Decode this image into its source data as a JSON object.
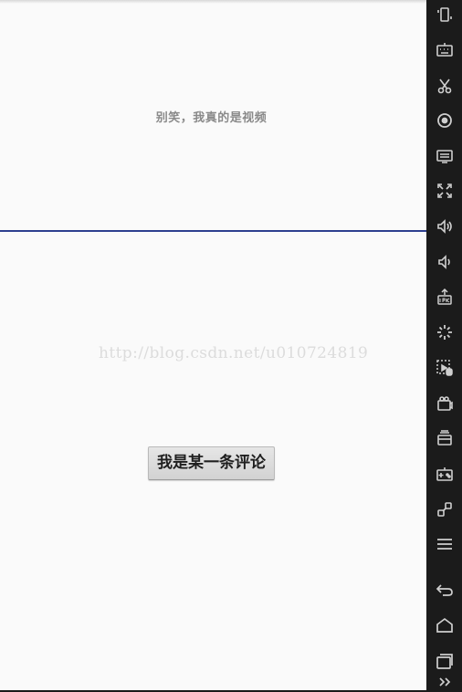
{
  "video": {
    "text": "别笑，我真的是视频"
  },
  "watermark": {
    "text": "http://blog.csdn.net/u010724819"
  },
  "comment": {
    "button_label": "我是某一条评论"
  },
  "sidebar": {
    "icons": [
      "rotate-device-icon",
      "keyboard-icon",
      "scissors-icon",
      "location-icon",
      "display-icon",
      "fullscreen-icon",
      "volume-up-icon",
      "volume-down-icon",
      "apk-install-icon",
      "brightness-icon",
      "screen-record-icon",
      "camera-icon",
      "sd-card-icon",
      "gamepad-icon",
      "link-icon",
      "menu-icon",
      "back-icon",
      "home-icon",
      "recent-apps-icon",
      "more-icon"
    ]
  },
  "colors": {
    "divider": "#2e3f8f",
    "background": "#fafafa",
    "sidebar": "#1b1b1b"
  }
}
